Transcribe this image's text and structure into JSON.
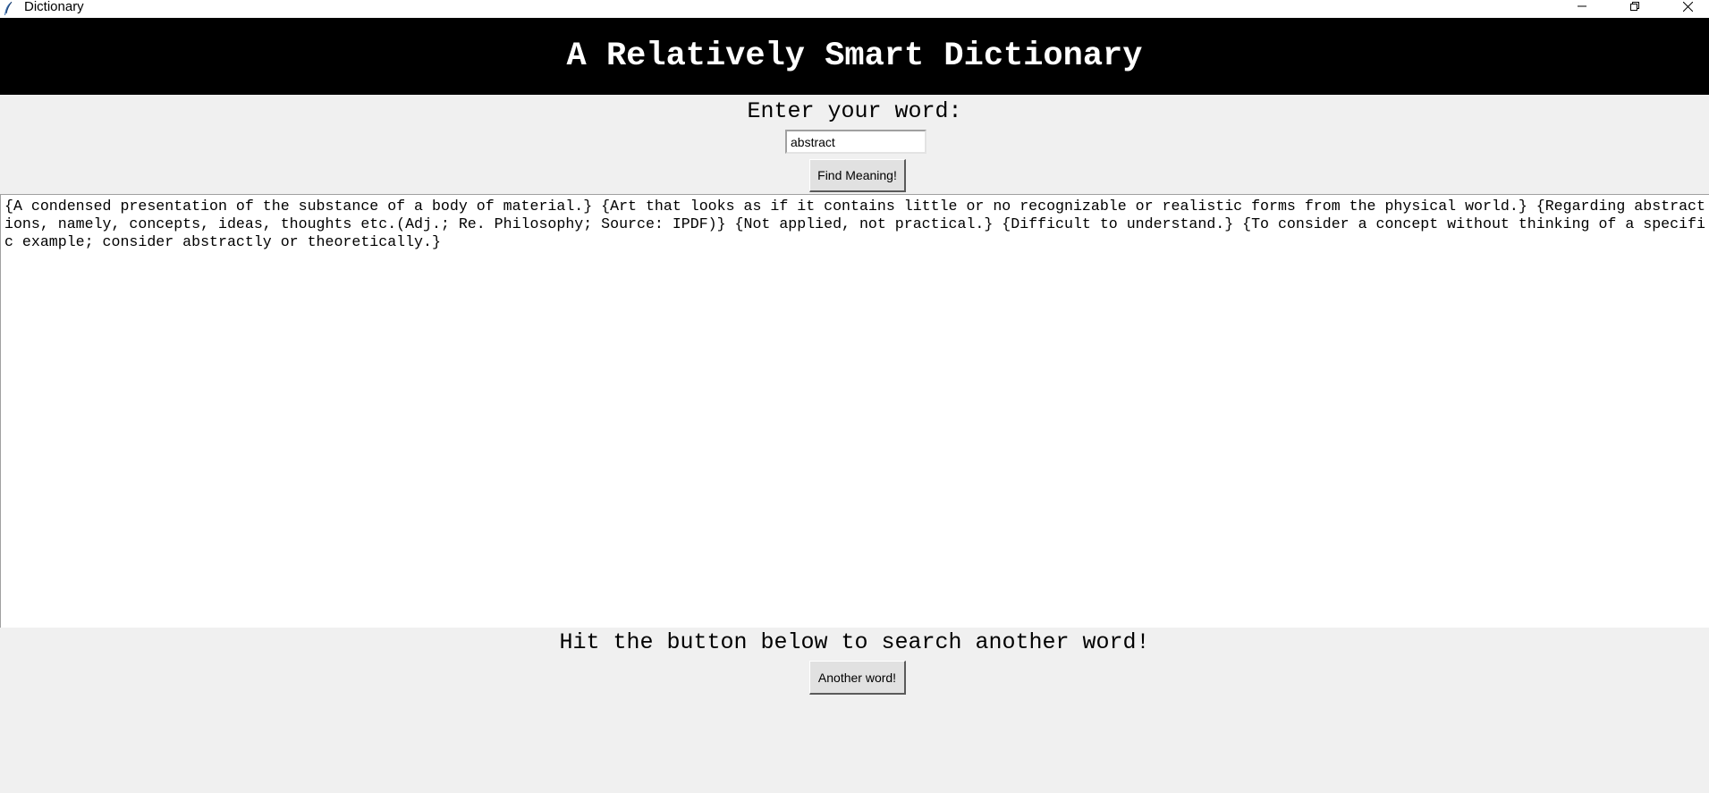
{
  "window": {
    "title": "Dictionary"
  },
  "header": {
    "title": "A Relatively Smart Dictionary",
    "background": "#000000",
    "color": "#ffffff"
  },
  "search": {
    "label": "Enter your word:",
    "value": "abstract",
    "button_label": "Find Meaning!"
  },
  "results": {
    "lines": [
      "{A condensed presentation of the substance of a body of material.} {Art that looks as if it contains little or no recognizable or realistic forms from the physical world.} {Regarding abstract",
      "ions, namely, concepts, ideas, thoughts etc.(Adj.; Re. Philosophy; Source: IPDF)} {Not applied, not practical.} {Difficult to understand.} {To consider a concept without thinking of a specifi",
      "c example; consider abstractly or theoretically.}"
    ]
  },
  "another": {
    "label": "Hit the button below to search another word!",
    "button_label": "Another word!"
  },
  "icons": {
    "app": "feather-icon",
    "minimize": "minimize-icon",
    "maximize": "restore-icon",
    "close": "close-icon"
  }
}
